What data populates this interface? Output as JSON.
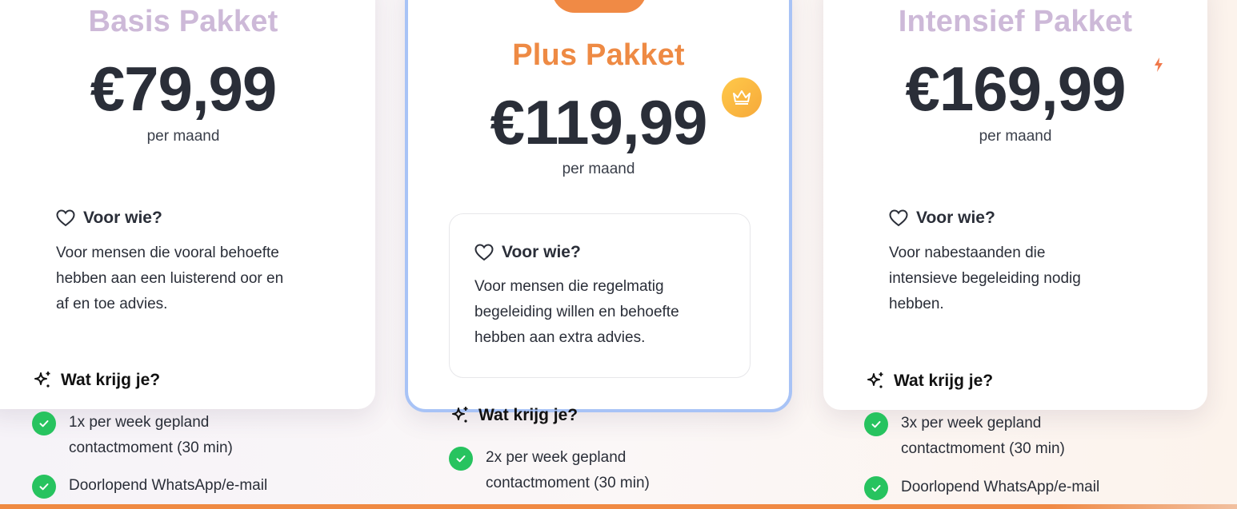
{
  "plans": {
    "basis": {
      "title": "Basis Pakket",
      "price": "€79,99",
      "period": "per maand",
      "for_head": "Voor wie?",
      "for_lines": [
        "Voor mensen die vooral behoefte",
        "hebben aan een luisterend oor en",
        "af en toe advies."
      ],
      "get_head": "Wat krijg je?",
      "features": [
        {
          "lines": [
            "1x per week gepland",
            "contactmoment (30 min)"
          ]
        },
        {
          "lines": [
            "Doorlopend WhatsApp/e-mail"
          ]
        }
      ]
    },
    "plus": {
      "title": "Plus Pakket",
      "price": "€119,99",
      "period": "per maand",
      "for_head": "Voor wie?",
      "for_lines": [
        "Voor mensen die regelmatig",
        "begeleiding willen en behoefte",
        "hebben aan extra advies."
      ],
      "get_head": "Wat krijg je?",
      "features": [
        {
          "lines": [
            "2x per week gepland",
            "contactmoment (30 min)"
          ]
        }
      ]
    },
    "intensief": {
      "title": "Intensief Pakket",
      "price": "€169,99",
      "period": "per maand",
      "for_head": "Voor wie?",
      "for_lines": [
        "Voor nabestaanden die",
        "intensieve begeleiding nodig",
        "hebben."
      ],
      "get_head": "Wat krijg je?",
      "features": [
        {
          "lines": [
            "3x per week gepland",
            "contactmoment (30 min)"
          ]
        },
        {
          "lines": [
            "Doorlopend WhatsApp/e-mail"
          ]
        }
      ]
    }
  },
  "icons": {
    "heart": "heart-icon",
    "sparkle": "sparkle-icon",
    "check": "check-circle-icon",
    "crown": "crown-icon",
    "bolt": "bolt-icon"
  },
  "colors": {
    "accent_orange": "#ee8a44",
    "muted_title": "#cdb9d8",
    "check_green": "#27c35f",
    "highlight_border": "#a8c3f6",
    "crown_gold": "#ffc94a"
  }
}
